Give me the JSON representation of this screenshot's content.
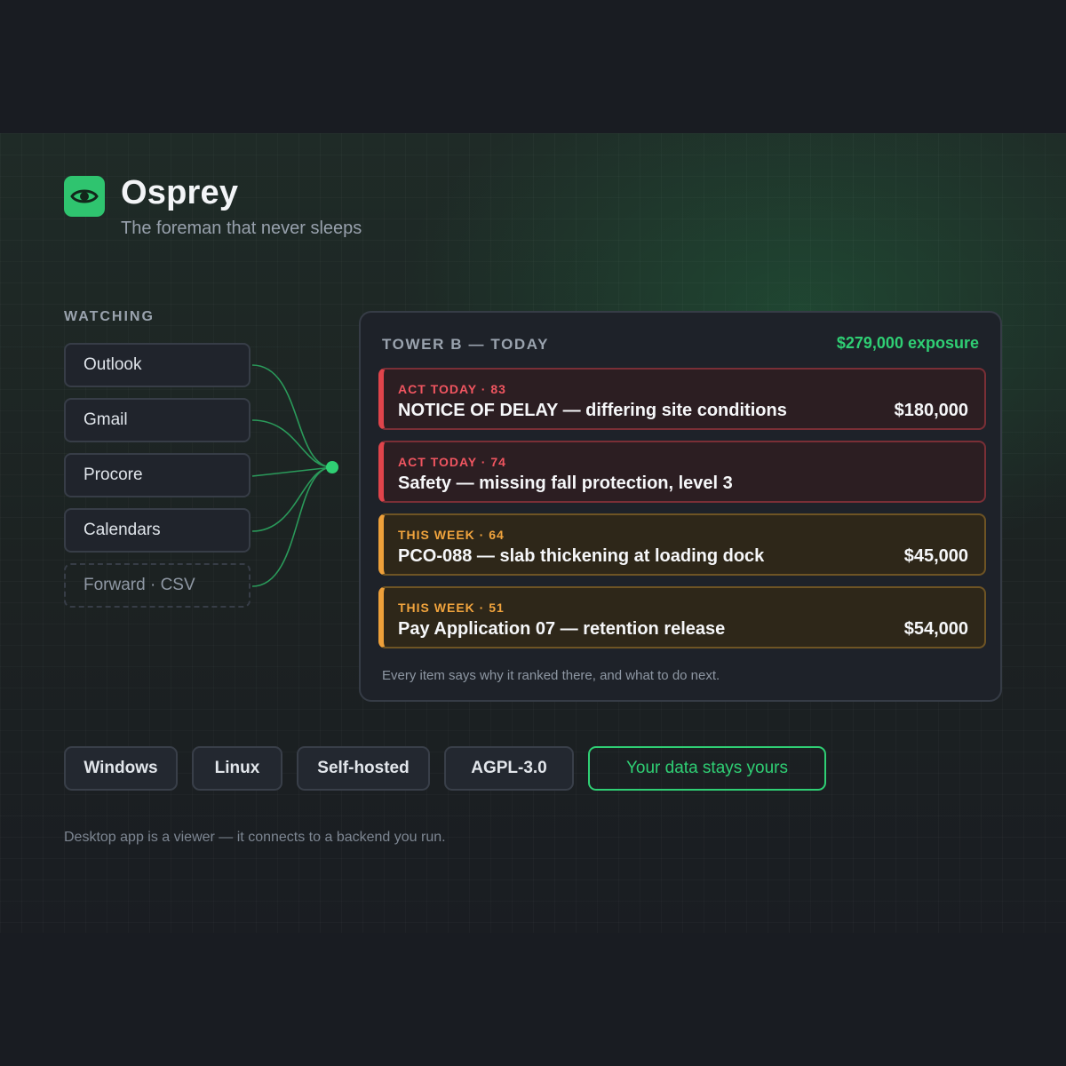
{
  "brand": {
    "name": "Osprey",
    "tagline": "The foreman that never sleeps",
    "logo_icon": "eye-icon",
    "accent": "#2fc46f"
  },
  "watching": {
    "label": "WATCHING",
    "sources": [
      "Outlook",
      "Gmail",
      "Procore",
      "Calendars",
      "Forward · CSV"
    ]
  },
  "panel": {
    "title": "TOWER B — TODAY",
    "exposure": "$279,000 exposure",
    "items": [
      {
        "tag": "ACT TODAY · 83",
        "text": "NOTICE OF DELAY — differing site conditions",
        "amount": "$180,000",
        "level": "red"
      },
      {
        "tag": "ACT TODAY · 74",
        "text": "Safety — missing fall protection, level 3",
        "amount": "",
        "level": "red"
      },
      {
        "tag": "THIS WEEK · 64",
        "text": "PCO-088 — slab thickening at loading dock",
        "amount": "$45,000",
        "level": "amber"
      },
      {
        "tag": "THIS WEEK · 51",
        "text": "Pay Application 07 — retention release",
        "amount": "$54,000",
        "level": "amber"
      }
    ],
    "footer": "Every item says why it ranked there, and what to do next."
  },
  "chips": [
    "Windows",
    "Linux",
    "Self-hosted",
    "AGPL-3.0",
    "Your data stays yours"
  ],
  "footnote": "Desktop app is a viewer — it connects to a backend you run.",
  "colors": {
    "red": "#e0444b",
    "amber": "#eea03a",
    "green": "#2fcf74"
  }
}
